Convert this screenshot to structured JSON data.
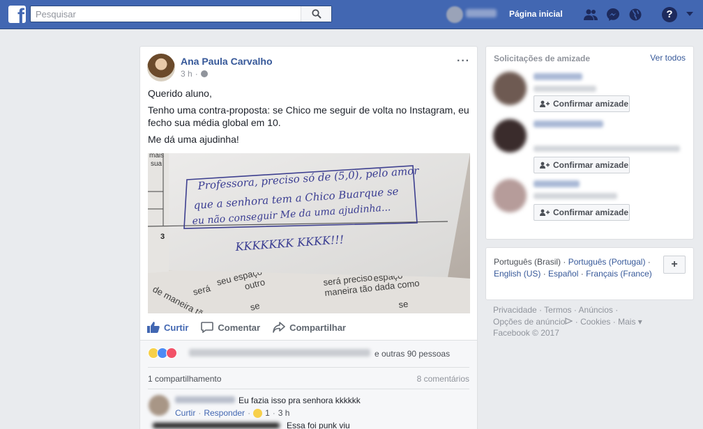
{
  "topbar": {
    "search_placeholder": "Pesquisar",
    "home_label": "Página inicial",
    "icons": [
      "friends-icon",
      "messenger-icon",
      "globe-icon",
      "help-icon",
      "caret-icon"
    ],
    "color": "#4267b2"
  },
  "post": {
    "author": "Ana Paula Carvalho",
    "time": "3 h",
    "options": "···",
    "paragraphs": [
      "Querido aluno,",
      "Tenho uma contra-proposta: se Chico me seguir de volta no Instagram, eu fecho sua média global em 10.",
      "Me dá uma ajudinha!"
    ],
    "image": {
      "note_lines": [
        "Professora, preciso só de (5,0), pelo amor",
        "que a senhora tem a Chico Buarque se",
        "eu não conseguir Me da uma ajudinha...",
        "KKKKKKK KKKK!!!"
      ],
      "margin_text": [
        "mais",
        "sua"
      ],
      "number": "3",
      "bottom_text_1": [
        "outro",
        "seu espaço",
        "será",
        "de maneira tão dado",
        "se"
      ],
      "bottom_text_2": [
        "será preciso",
        "espaço",
        "maneira tão dada como",
        "se"
      ]
    },
    "actions": {
      "like": "Curtir",
      "comment": "Comentar",
      "share": "Compartilhar"
    },
    "reactions_others": "e outras 90 pessoas",
    "shares": "1 compartilhamento",
    "comments_count": "8 comentários",
    "comment1": {
      "text": "Eu fazia isso pra senhora kkkkkk",
      "like": "Curtir",
      "reply": "Responder",
      "reaction_count": "1",
      "time": "3 h"
    },
    "comment2": {
      "text": "Essa foi punk viu"
    }
  },
  "friend_requests": {
    "title": "Solicitações de amizade",
    "see_all": "Ver todos",
    "confirm_label": "Confirmar amizade"
  },
  "languages": {
    "current": "Português (Brasil)",
    "others": [
      "Português (Portugal)",
      "English (US)",
      "Español",
      "Français (France)"
    ],
    "plus": "+"
  },
  "footer": {
    "links": [
      "Privacidade",
      "Termos",
      "Anúncios",
      "Opções de anúncio",
      "Cookies",
      "Mais"
    ],
    "copyright": "Facebook © 2017"
  }
}
